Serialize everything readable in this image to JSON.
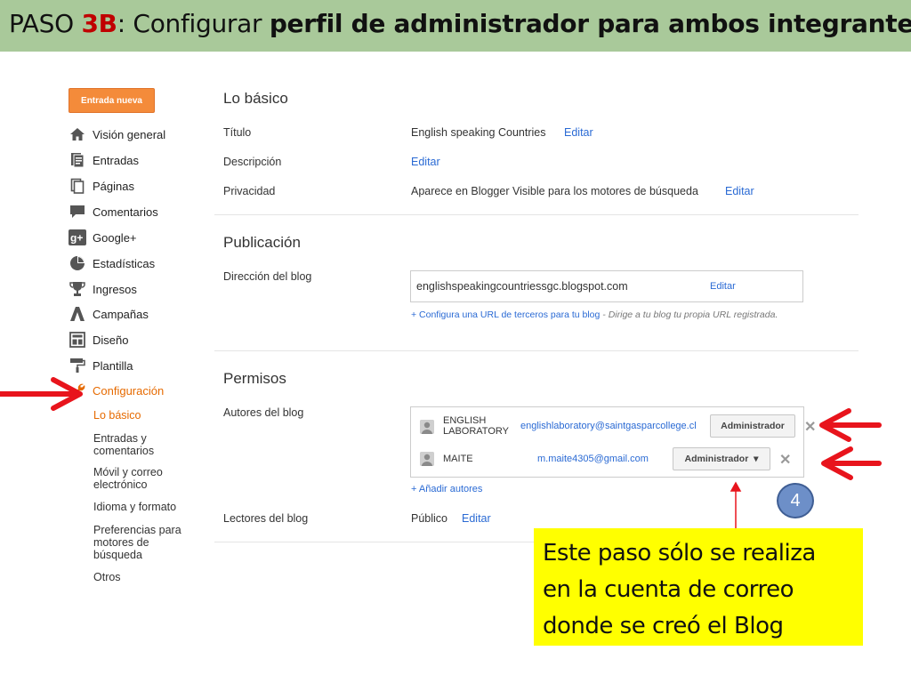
{
  "slide": {
    "title_pre": "PASO ",
    "title_step": "3B",
    "title_colon": ": Configurar ",
    "title_bold": "perfil de administrador para ambos integrantes"
  },
  "sidebar": {
    "new_post": "Entrada nueva",
    "items": [
      {
        "label": "Visión general",
        "icon": "home-icon"
      },
      {
        "label": "Entradas",
        "icon": "posts-icon"
      },
      {
        "label": "Páginas",
        "icon": "pages-icon"
      },
      {
        "label": "Comentarios",
        "icon": "comments-icon"
      },
      {
        "label": "Google+",
        "icon": "google-plus-icon"
      },
      {
        "label": "Estadísticas",
        "icon": "stats-icon"
      },
      {
        "label": "Ingresos",
        "icon": "trophy-icon"
      },
      {
        "label": "Campañas",
        "icon": "adwords-icon"
      },
      {
        "label": "Diseño",
        "icon": "layout-icon"
      },
      {
        "label": "Plantilla",
        "icon": "paint-roller-icon"
      },
      {
        "label": "Configuración",
        "icon": "wrench-icon"
      }
    ],
    "sub_items": [
      "Lo básico",
      "Entradas y comentarios",
      "Móvil y correo electrónico",
      "Idioma y formato",
      "Preferencias para motores de búsqueda",
      "Otros"
    ]
  },
  "basics": {
    "heading": "Lo básico",
    "title_label": "Título",
    "title_value": "English speaking Countries",
    "title_edit": "Editar",
    "desc_label": "Descripción",
    "desc_edit": "Editar",
    "privacy_label": "Privacidad",
    "privacy_value": "Aparece en Blogger Visible para los motores de búsqueda",
    "privacy_edit": "Editar"
  },
  "publishing": {
    "heading": "Publicación",
    "address_label": "Dirección del blog",
    "address_value": "englishspeakingcountriessgc.blogspot.com",
    "address_edit": "Editar",
    "custom_link": "+ Configura una URL de terceros para tu blog",
    "custom_note": " - Dirige a tu blog tu propia URL registrada."
  },
  "permissions": {
    "heading": "Permisos",
    "authors_label": "Autores del blog",
    "authors": [
      {
        "name": "ENGLISH LABORATORY",
        "email": "englishlaboratory@saintgasparcollege.cl",
        "role": "Administrador"
      },
      {
        "name": "MAITE",
        "email": "m.maite4305@gmail.com",
        "role": "Administrador",
        "role_caret": "▾"
      }
    ],
    "remove_symbol": "✕",
    "add_authors": "+ Añadir autores",
    "readers_label": "Lectores del blog",
    "readers_value": "Público",
    "readers_edit": "Editar"
  },
  "annotation": {
    "step_number": "4",
    "note_lines": [
      "Este paso sólo se realiza",
      "en la cuenta de correo",
      "donde se creó el Blog"
    ],
    "arrow_color": "#e8141c"
  },
  "colors": {
    "title_bar": "#a9c99a",
    "accent_step": "#c00000",
    "blogger_orange": "#f48b3a",
    "active_nav": "#e66a00",
    "link": "#2a6ad4",
    "note_bg": "#ffff00",
    "step_circle": "#6d8fc8"
  }
}
